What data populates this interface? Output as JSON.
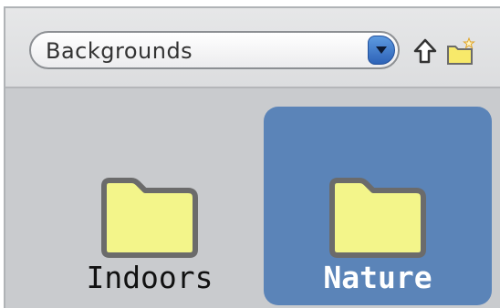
{
  "toolbar": {
    "folder_dropdown": {
      "selected": "Backgrounds",
      "arrow_icon": "chevron-down-icon"
    },
    "buttons": [
      {
        "icon": "up-arrow-icon"
      },
      {
        "icon": "new-folder-icon"
      }
    ]
  },
  "folders": [
    {
      "label": "Indoors",
      "selected": false,
      "icon": "folder-icon"
    },
    {
      "label": "Nature",
      "selected": true,
      "icon": "folder-icon"
    }
  ],
  "colors": {
    "selection": "#5b84b8",
    "folder_fill": "#f3f58a",
    "folder_outline": "#6b6b6b",
    "panel_bg": "#c9cbce",
    "dropdown_arrow": "#2e63b8"
  }
}
